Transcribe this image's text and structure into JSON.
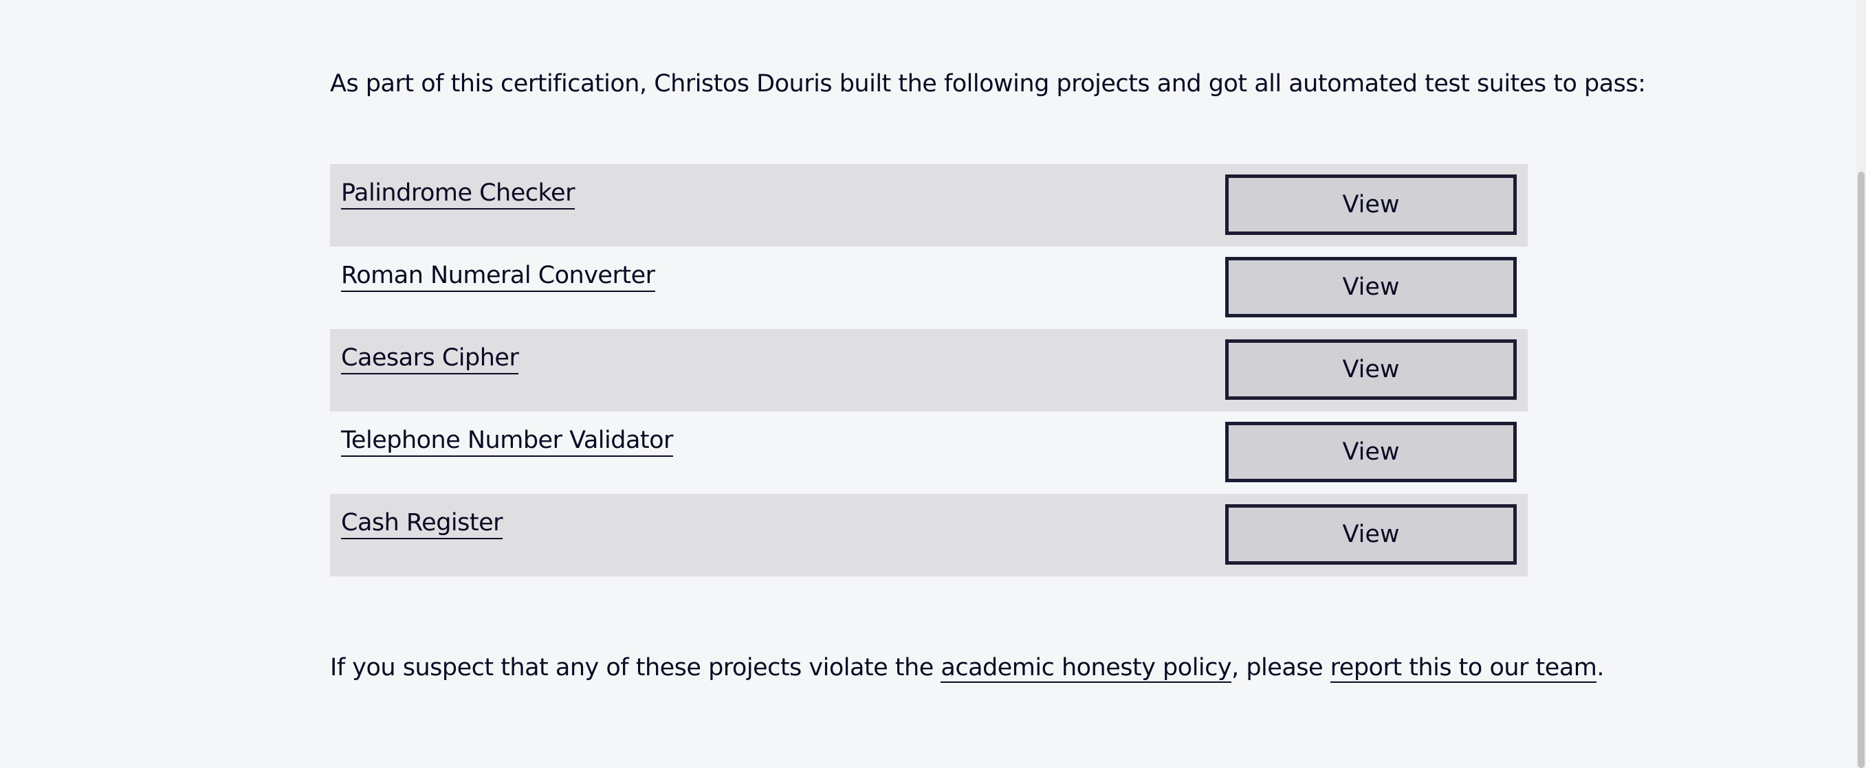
{
  "intro_text": "As part of this certification, Christos Douris built the following projects and got all automated test suites to pass:",
  "projects": [
    {
      "name": "Palindrome Checker",
      "button": "View"
    },
    {
      "name": "Roman Numeral Converter",
      "button": "View"
    },
    {
      "name": "Caesars Cipher",
      "button": "View"
    },
    {
      "name": "Telephone Number Validator",
      "button": "View"
    },
    {
      "name": "Cash Register",
      "button": "View"
    }
  ],
  "footer": {
    "prefix": "If you suspect that any of these projects violate the ",
    "policy_link": "academic honesty policy",
    "middle": ", please ",
    "report_link": "report this to our team",
    "suffix": "."
  },
  "colors": {
    "background": "#f5f6f7",
    "row_shaded": "#dfdfe2",
    "button_bg": "#d0d0d5",
    "button_border": "#1b1b32",
    "text": "#0a0a23"
  }
}
